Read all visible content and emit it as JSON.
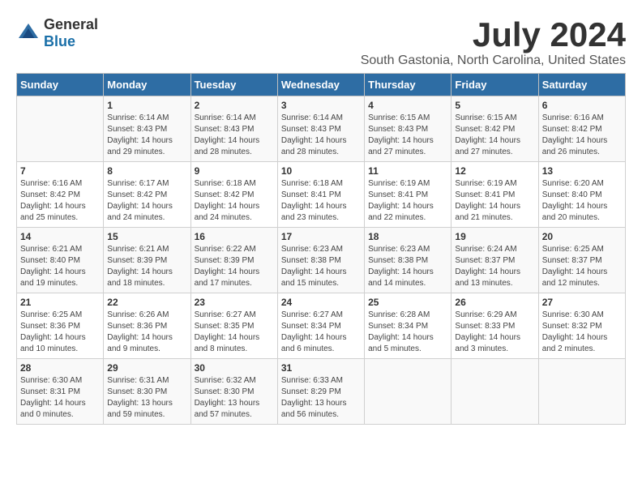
{
  "logo": {
    "general": "General",
    "blue": "Blue"
  },
  "title": "July 2024",
  "subtitle": "South Gastonia, North Carolina, United States",
  "days_of_week": [
    "Sunday",
    "Monday",
    "Tuesday",
    "Wednesday",
    "Thursday",
    "Friday",
    "Saturday"
  ],
  "weeks": [
    [
      {
        "day": "",
        "sunrise": "",
        "sunset": "",
        "daylight": ""
      },
      {
        "day": "1",
        "sunrise": "Sunrise: 6:14 AM",
        "sunset": "Sunset: 8:43 PM",
        "daylight": "Daylight: 14 hours and 29 minutes."
      },
      {
        "day": "2",
        "sunrise": "Sunrise: 6:14 AM",
        "sunset": "Sunset: 8:43 PM",
        "daylight": "Daylight: 14 hours and 28 minutes."
      },
      {
        "day": "3",
        "sunrise": "Sunrise: 6:14 AM",
        "sunset": "Sunset: 8:43 PM",
        "daylight": "Daylight: 14 hours and 28 minutes."
      },
      {
        "day": "4",
        "sunrise": "Sunrise: 6:15 AM",
        "sunset": "Sunset: 8:43 PM",
        "daylight": "Daylight: 14 hours and 27 minutes."
      },
      {
        "day": "5",
        "sunrise": "Sunrise: 6:15 AM",
        "sunset": "Sunset: 8:42 PM",
        "daylight": "Daylight: 14 hours and 27 minutes."
      },
      {
        "day": "6",
        "sunrise": "Sunrise: 6:16 AM",
        "sunset": "Sunset: 8:42 PM",
        "daylight": "Daylight: 14 hours and 26 minutes."
      }
    ],
    [
      {
        "day": "7",
        "sunrise": "Sunrise: 6:16 AM",
        "sunset": "Sunset: 8:42 PM",
        "daylight": "Daylight: 14 hours and 25 minutes."
      },
      {
        "day": "8",
        "sunrise": "Sunrise: 6:17 AM",
        "sunset": "Sunset: 8:42 PM",
        "daylight": "Daylight: 14 hours and 24 minutes."
      },
      {
        "day": "9",
        "sunrise": "Sunrise: 6:18 AM",
        "sunset": "Sunset: 8:42 PM",
        "daylight": "Daylight: 14 hours and 24 minutes."
      },
      {
        "day": "10",
        "sunrise": "Sunrise: 6:18 AM",
        "sunset": "Sunset: 8:41 PM",
        "daylight": "Daylight: 14 hours and 23 minutes."
      },
      {
        "day": "11",
        "sunrise": "Sunrise: 6:19 AM",
        "sunset": "Sunset: 8:41 PM",
        "daylight": "Daylight: 14 hours and 22 minutes."
      },
      {
        "day": "12",
        "sunrise": "Sunrise: 6:19 AM",
        "sunset": "Sunset: 8:41 PM",
        "daylight": "Daylight: 14 hours and 21 minutes."
      },
      {
        "day": "13",
        "sunrise": "Sunrise: 6:20 AM",
        "sunset": "Sunset: 8:40 PM",
        "daylight": "Daylight: 14 hours and 20 minutes."
      }
    ],
    [
      {
        "day": "14",
        "sunrise": "Sunrise: 6:21 AM",
        "sunset": "Sunset: 8:40 PM",
        "daylight": "Daylight: 14 hours and 19 minutes."
      },
      {
        "day": "15",
        "sunrise": "Sunrise: 6:21 AM",
        "sunset": "Sunset: 8:39 PM",
        "daylight": "Daylight: 14 hours and 18 minutes."
      },
      {
        "day": "16",
        "sunrise": "Sunrise: 6:22 AM",
        "sunset": "Sunset: 8:39 PM",
        "daylight": "Daylight: 14 hours and 17 minutes."
      },
      {
        "day": "17",
        "sunrise": "Sunrise: 6:23 AM",
        "sunset": "Sunset: 8:38 PM",
        "daylight": "Daylight: 14 hours and 15 minutes."
      },
      {
        "day": "18",
        "sunrise": "Sunrise: 6:23 AM",
        "sunset": "Sunset: 8:38 PM",
        "daylight": "Daylight: 14 hours and 14 minutes."
      },
      {
        "day": "19",
        "sunrise": "Sunrise: 6:24 AM",
        "sunset": "Sunset: 8:37 PM",
        "daylight": "Daylight: 14 hours and 13 minutes."
      },
      {
        "day": "20",
        "sunrise": "Sunrise: 6:25 AM",
        "sunset": "Sunset: 8:37 PM",
        "daylight": "Daylight: 14 hours and 12 minutes."
      }
    ],
    [
      {
        "day": "21",
        "sunrise": "Sunrise: 6:25 AM",
        "sunset": "Sunset: 8:36 PM",
        "daylight": "Daylight: 14 hours and 10 minutes."
      },
      {
        "day": "22",
        "sunrise": "Sunrise: 6:26 AM",
        "sunset": "Sunset: 8:36 PM",
        "daylight": "Daylight: 14 hours and 9 minutes."
      },
      {
        "day": "23",
        "sunrise": "Sunrise: 6:27 AM",
        "sunset": "Sunset: 8:35 PM",
        "daylight": "Daylight: 14 hours and 8 minutes."
      },
      {
        "day": "24",
        "sunrise": "Sunrise: 6:27 AM",
        "sunset": "Sunset: 8:34 PM",
        "daylight": "Daylight: 14 hours and 6 minutes."
      },
      {
        "day": "25",
        "sunrise": "Sunrise: 6:28 AM",
        "sunset": "Sunset: 8:34 PM",
        "daylight": "Daylight: 14 hours and 5 minutes."
      },
      {
        "day": "26",
        "sunrise": "Sunrise: 6:29 AM",
        "sunset": "Sunset: 8:33 PM",
        "daylight": "Daylight: 14 hours and 3 minutes."
      },
      {
        "day": "27",
        "sunrise": "Sunrise: 6:30 AM",
        "sunset": "Sunset: 8:32 PM",
        "daylight": "Daylight: 14 hours and 2 minutes."
      }
    ],
    [
      {
        "day": "28",
        "sunrise": "Sunrise: 6:30 AM",
        "sunset": "Sunset: 8:31 PM",
        "daylight": "Daylight: 14 hours and 0 minutes."
      },
      {
        "day": "29",
        "sunrise": "Sunrise: 6:31 AM",
        "sunset": "Sunset: 8:30 PM",
        "daylight": "Daylight: 13 hours and 59 minutes."
      },
      {
        "day": "30",
        "sunrise": "Sunrise: 6:32 AM",
        "sunset": "Sunset: 8:30 PM",
        "daylight": "Daylight: 13 hours and 57 minutes."
      },
      {
        "day": "31",
        "sunrise": "Sunrise: 6:33 AM",
        "sunset": "Sunset: 8:29 PM",
        "daylight": "Daylight: 13 hours and 56 minutes."
      },
      {
        "day": "",
        "sunrise": "",
        "sunset": "",
        "daylight": ""
      },
      {
        "day": "",
        "sunrise": "",
        "sunset": "",
        "daylight": ""
      },
      {
        "day": "",
        "sunrise": "",
        "sunset": "",
        "daylight": ""
      }
    ]
  ]
}
